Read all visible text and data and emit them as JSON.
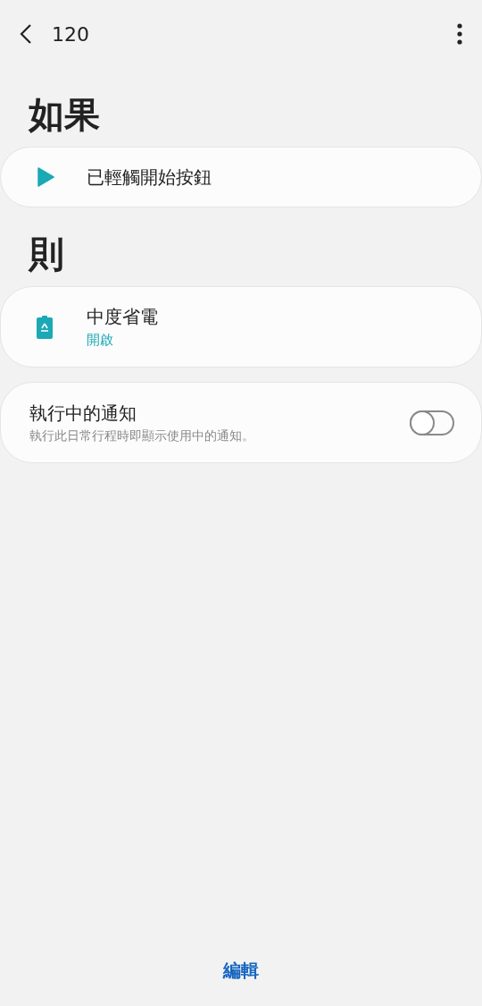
{
  "header": {
    "title": "120"
  },
  "if_section": {
    "heading": "如果",
    "items": [
      {
        "kind": "trigger",
        "label": "已輕觸開始按鈕"
      }
    ]
  },
  "then_section": {
    "heading": "則",
    "items": [
      {
        "kind": "action",
        "label": "中度省電",
        "status": "開啟"
      }
    ]
  },
  "notification": {
    "title": "執行中的通知",
    "description": "執行此日常行程時即顯示使用中的通知。",
    "on": false
  },
  "bottom_button": "編輯"
}
